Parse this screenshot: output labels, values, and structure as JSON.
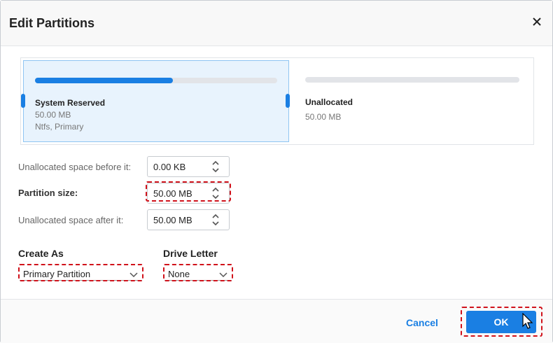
{
  "dialog": {
    "title": "Edit Partitions",
    "close_icon": "close-icon"
  },
  "partitions": [
    {
      "name": "System Reserved",
      "size": "50.00 MB",
      "details": "Ntfs, Primary",
      "used_fraction": 0.57,
      "selected": true
    },
    {
      "name": "Unallocated",
      "size": "50.00 MB",
      "used_fraction": 0.0,
      "selected": false
    }
  ],
  "fields": {
    "before": {
      "label": "Unallocated space before it:",
      "value": "0.00 KB"
    },
    "size": {
      "label": "Partition size:",
      "value": "50.00 MB"
    },
    "after": {
      "label": "Unallocated space after it:",
      "value": "50.00 MB"
    }
  },
  "create_as": {
    "label": "Create As",
    "value": "Primary Partition"
  },
  "drive_letter": {
    "label": "Drive Letter",
    "value": "None"
  },
  "footer": {
    "cancel_label": "Cancel",
    "ok_label": "OK"
  },
  "colors": {
    "accent": "#1a7fe3",
    "highlight_dash": "#d0121b",
    "selected_bg": "#e8f3fd"
  }
}
